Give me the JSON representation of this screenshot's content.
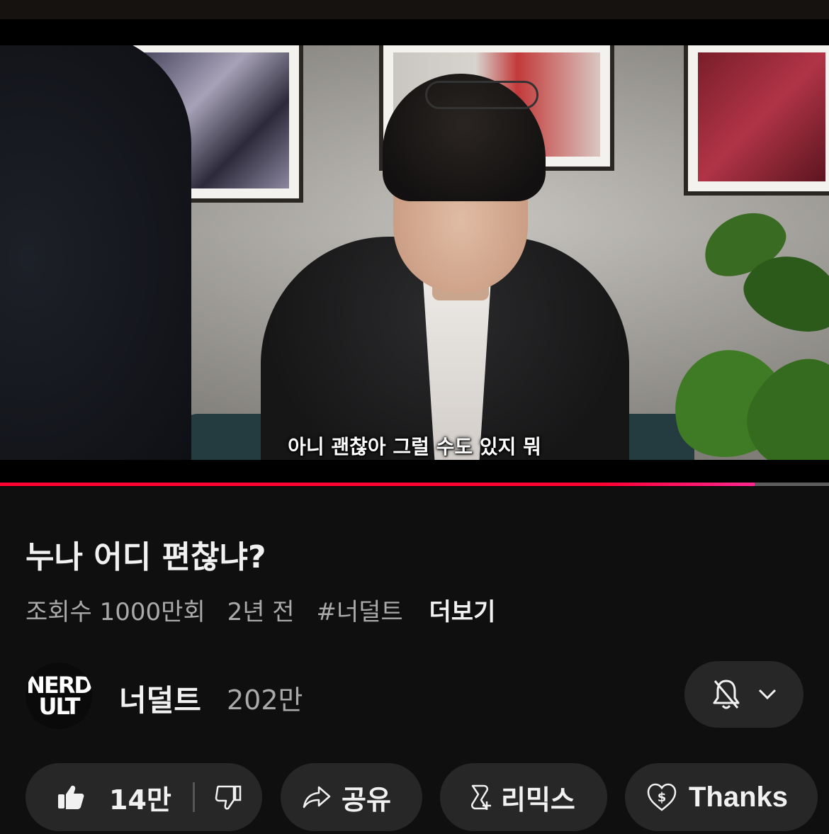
{
  "video": {
    "subtitle": "아니 괜찮아 그럴 수도 있지 뭐",
    "progress_fraction": 0.91
  },
  "details": {
    "title": "누나 어디 편찮냐?",
    "views": "조회수 1000만회",
    "age": "2년 전",
    "hashtag": "#너덜트",
    "more_label": "더보기"
  },
  "channel": {
    "logo_line1": "NERD",
    "logo_line2": "ULT",
    "name": "너덜트",
    "subscribers": "202만"
  },
  "actions": {
    "like_count": "14만",
    "share_label": "공유",
    "remix_label": "리믹스",
    "thanks_label": "Thanks"
  },
  "icons": {
    "like": "thumbs-up-icon",
    "dislike": "thumbs-down-icon",
    "share": "share-arrow-icon",
    "remix": "remix-icon",
    "thanks": "heart-dollar-icon",
    "notifications": "bell-off-icon",
    "dropdown": "chevron-down-icon"
  },
  "colors": {
    "background": "#0f0f0f",
    "pill": "#272727",
    "progress": "#ff0033",
    "secondary_text": "#aaaaaa"
  }
}
